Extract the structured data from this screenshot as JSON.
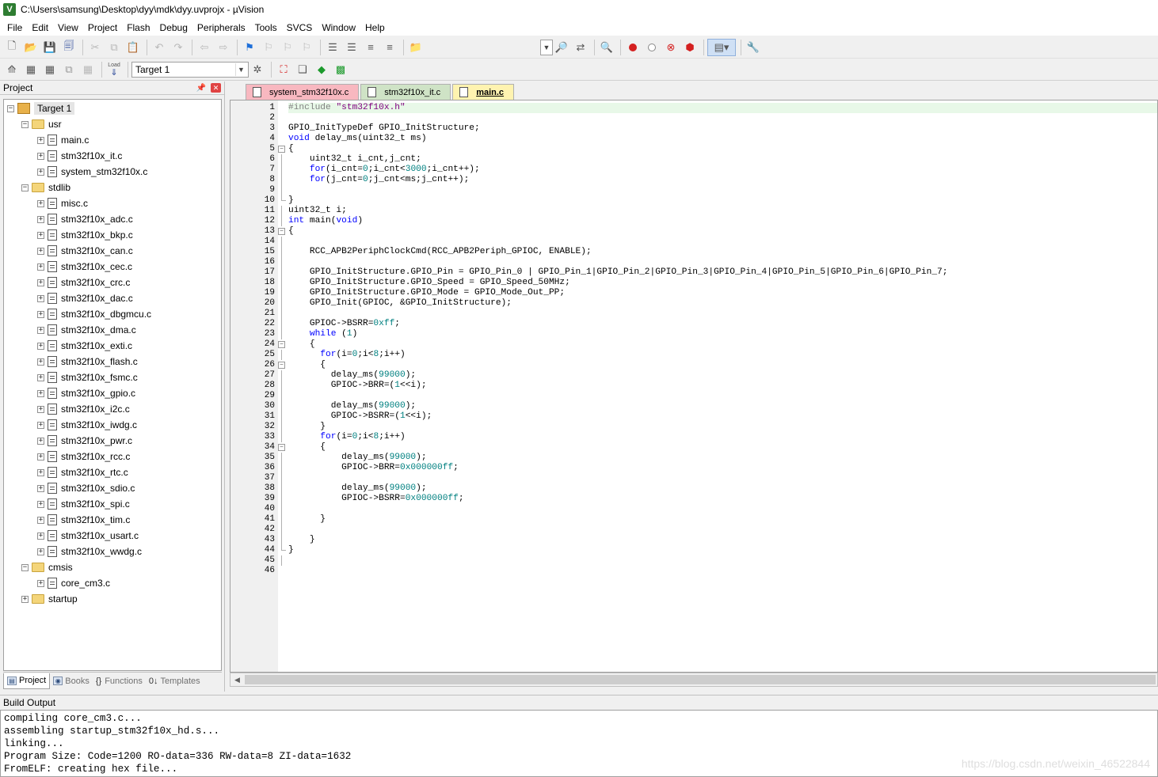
{
  "window": {
    "title": "C:\\Users\\samsung\\Desktop\\dyy\\mdk\\dyy.uvprojx - µVision",
    "icon": "app-icon"
  },
  "menu": [
    "File",
    "Edit",
    "View",
    "Project",
    "Flash",
    "Debug",
    "Peripherals",
    "Tools",
    "SVCS",
    "Window",
    "Help"
  ],
  "toolbar2": {
    "load_label": "Load",
    "target_select": "Target 1"
  },
  "project_panel": {
    "title": "Project",
    "tree": {
      "root": "Target 1",
      "groups": [
        {
          "name": "usr",
          "files": [
            "main.c",
            "stm32f10x_it.c",
            "system_stm32f10x.c"
          ]
        },
        {
          "name": "stdlib",
          "files": [
            "misc.c",
            "stm32f10x_adc.c",
            "stm32f10x_bkp.c",
            "stm32f10x_can.c",
            "stm32f10x_cec.c",
            "stm32f10x_crc.c",
            "stm32f10x_dac.c",
            "stm32f10x_dbgmcu.c",
            "stm32f10x_dma.c",
            "stm32f10x_exti.c",
            "stm32f10x_flash.c",
            "stm32f10x_fsmc.c",
            "stm32f10x_gpio.c",
            "stm32f10x_i2c.c",
            "stm32f10x_iwdg.c",
            "stm32f10x_pwr.c",
            "stm32f10x_rcc.c",
            "stm32f10x_rtc.c",
            "stm32f10x_sdio.c",
            "stm32f10x_spi.c",
            "stm32f10x_tim.c",
            "stm32f10x_usart.c",
            "stm32f10x_wwdg.c"
          ]
        },
        {
          "name": "cmsis",
          "files": [
            "core_cm3.c"
          ]
        },
        {
          "name": "startup",
          "files": []
        }
      ]
    },
    "bottom_tabs": [
      "Project",
      "Books",
      "Functions",
      "Templates"
    ]
  },
  "editor": {
    "tabs": [
      "system_stm32f10x.c",
      "stm32f10x_it.c",
      "main.c"
    ],
    "active_tab": "main.c",
    "lines": [
      "#include \"stm32f10x.h\"",
      "",
      "GPIO_InitTypeDef GPIO_InitStructure;",
      "void delay_ms(uint32_t ms)",
      "{",
      "    uint32_t i_cnt,j_cnt;",
      "    for(i_cnt=0;i_cnt<3000;i_cnt++);",
      "    for(j_cnt=0;j_cnt<ms;j_cnt++);",
      "",
      "}",
      "uint32_t i;",
      "int main(void)",
      "{",
      "",
      "    RCC_APB2PeriphClockCmd(RCC_APB2Periph_GPIOC, ENABLE);",
      "",
      "    GPIO_InitStructure.GPIO_Pin = GPIO_Pin_0 | GPIO_Pin_1|GPIO_Pin_2|GPIO_Pin_3|GPIO_Pin_4|GPIO_Pin_5|GPIO_Pin_6|GPIO_Pin_7;",
      "    GPIO_InitStructure.GPIO_Speed = GPIO_Speed_50MHz;",
      "    GPIO_InitStructure.GPIO_Mode = GPIO_Mode_Out_PP;",
      "    GPIO_Init(GPIOC, &GPIO_InitStructure);",
      "",
      "    GPIOC->BSRR=0xff;",
      "    while (1)",
      "    {",
      "      for(i=0;i<8;i++)",
      "      {",
      "        delay_ms(99000);",
      "        GPIOC->BRR=(1<<i);",
      "",
      "        delay_ms(99000);",
      "        GPIOC->BSRR=(1<<i);",
      "      }",
      "      for(i=0;i<8;i++)",
      "      {",
      "          delay_ms(99000);",
      "          GPIOC->BRR=0x000000ff;",
      "",
      "          delay_ms(99000);",
      "          GPIOC->BSRR=0x000000ff;",
      "",
      "      }",
      "",
      "    }",
      "}",
      "",
      ""
    ]
  },
  "build_output": {
    "title": "Build Output",
    "lines": [
      "compiling core_cm3.c...",
      "assembling startup_stm32f10x_hd.s...",
      "linking...",
      "Program Size: Code=1200 RO-data=336 RW-data=8 ZI-data=1632",
      "FromELF: creating hex file..."
    ]
  },
  "watermark": "https://blog.csdn.net/weixin_46522844"
}
